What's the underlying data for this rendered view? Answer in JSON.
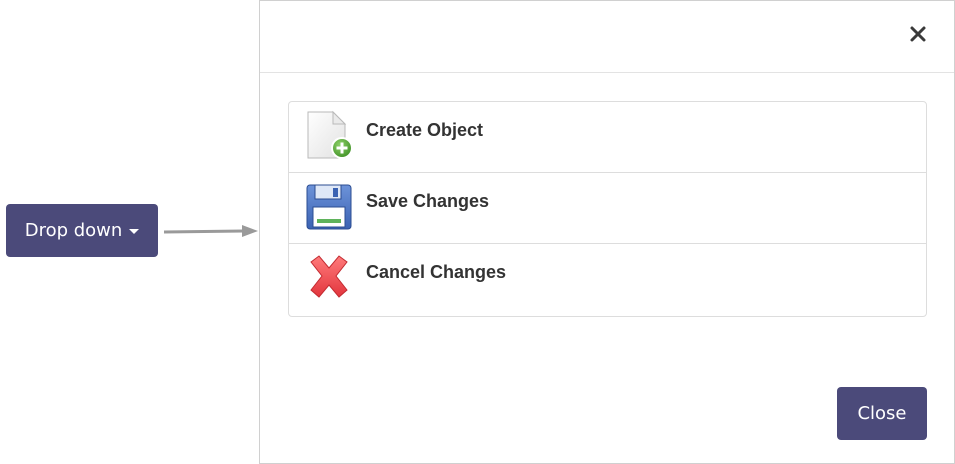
{
  "dropdown": {
    "label": "Drop down",
    "accent_color": "#4b4a7a"
  },
  "modal": {
    "close_icon": "close-icon",
    "items": [
      {
        "label": "Create Object",
        "icon": "create-object-icon"
      },
      {
        "label": "Save Changes",
        "icon": "save-icon"
      },
      {
        "label": "Cancel Changes",
        "icon": "cancel-icon"
      }
    ],
    "close_button_label": "Close"
  }
}
